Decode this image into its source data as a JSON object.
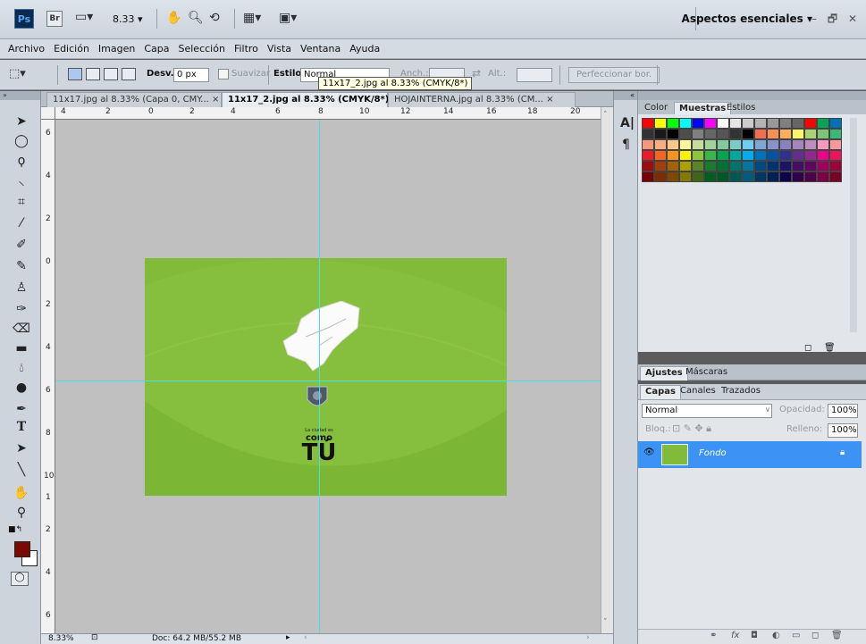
{
  "app": {
    "logo": "Ps",
    "bridge": "Br",
    "zoom": "8.33",
    "workspace": "Aspectos esenciales"
  },
  "menu": [
    "Archivo",
    "Edición",
    "Imagen",
    "Capa",
    "Selección",
    "Filtro",
    "Vista",
    "Ventana",
    "Ayuda"
  ],
  "options": {
    "desv_label": "Desv.:",
    "desv_value": "0 px",
    "suavizar": "Suavizar",
    "estilo_label": "Estilo:",
    "estilo_value": "Normal",
    "anch_label": "Anch.:",
    "alt_label": "Alt.:",
    "refine": "Perfeccionar bor."
  },
  "tooltip": "11x17_2.jpg al 8.33% (CMYK/8*)",
  "doc_tabs": [
    {
      "label": "11x17.jpg al 8.33% (Capa 0, CMY...",
      "close": "×"
    },
    {
      "label": "11x17_2.jpg al 8.33% (CMYK/8*)",
      "close": "×"
    },
    {
      "label": "HOJAINTERNA.jpg al 8.33% (CM...",
      "close": "×"
    }
  ],
  "ruler_h": [
    "4",
    "2",
    "0",
    "2",
    "4",
    "6",
    "8",
    "10",
    "12",
    "14",
    "16",
    "18",
    "20"
  ],
  "ruler_v": [
    "6",
    "4",
    "2",
    "0",
    "2",
    "4",
    "6",
    "8",
    "10",
    "1",
    "2",
    "4",
    "6"
  ],
  "artwork": {
    "tagline": "La ciudad es",
    "word": "como",
    "big": "TÚ"
  },
  "status": {
    "zoom": "8.33%",
    "doc": "Doc: 64.2 MB/55.2 MB"
  },
  "swatch_tabs": [
    "Color",
    "Muestras",
    "Estilos"
  ],
  "adjust_tabs": [
    "Ajustes",
    "Máscaras"
  ],
  "layers_tabs": [
    "Capas",
    "Canales",
    "Trazados"
  ],
  "layers": {
    "blend": "Normal",
    "opacity_label": "Opacidad:",
    "opacity": "100%",
    "lock_label": "Bloq.:",
    "fill_label": "Relleno:",
    "fill": "100%",
    "layer_name": "Fondo"
  },
  "swatches": [
    "#ff0000",
    "#ffff00",
    "#00ff00",
    "#00ffff",
    "#0000ff",
    "#ff00ff",
    "#ffffff",
    "#e6e6e6",
    "#cccccc",
    "#b3b3b3",
    "#999999",
    "#808080",
    "#666666",
    "#ff0000",
    "#00a651",
    "#0072bc",
    "#333333",
    "#1a1a1a",
    "#000000",
    "#4d4d4d",
    "#808080",
    "#666666",
    "#555555",
    "#333333",
    "#000000",
    "#f26c4f",
    "#f68e56",
    "#fbaf5d",
    "#fff568",
    "#acd373",
    "#7cc576",
    "#3bb878",
    "#f7977a",
    "#f9ad81",
    "#fdc68a",
    "#fff79a",
    "#c4df9b",
    "#a3d39c",
    "#82ca9d",
    "#7bcdc8",
    "#6ecff6",
    "#7ea7d8",
    "#8493ca",
    "#8882be",
    "#a187be",
    "#bc8dbf",
    "#f49ac2",
    "#f6989d",
    "#ed1c24",
    "#f26522",
    "#f7941d",
    "#fff200",
    "#8dc63f",
    "#39b54a",
    "#00a651",
    "#00a99d",
    "#00aeef",
    "#0072bc",
    "#0054a6",
    "#2e3192",
    "#662d91",
    "#92278f",
    "#ec008c",
    "#ed145b",
    "#9e0b0f",
    "#a0410d",
    "#a3620a",
    "#aba000",
    "#598527",
    "#197b30",
    "#007236",
    "#00746b",
    "#0076a3",
    "#004a80",
    "#003471",
    "#1b1464",
    "#440e62",
    "#630460",
    "#9e005d",
    "#9e0039",
    "#790000",
    "#7b2e00",
    "#7d4900",
    "#827b00",
    "#406618",
    "#005e20",
    "#005826",
    "#005952",
    "#005b7f",
    "#003663",
    "#002157",
    "#0d004c",
    "#32004b",
    "#4b0049",
    "#7b0046",
    "#7a0026"
  ]
}
